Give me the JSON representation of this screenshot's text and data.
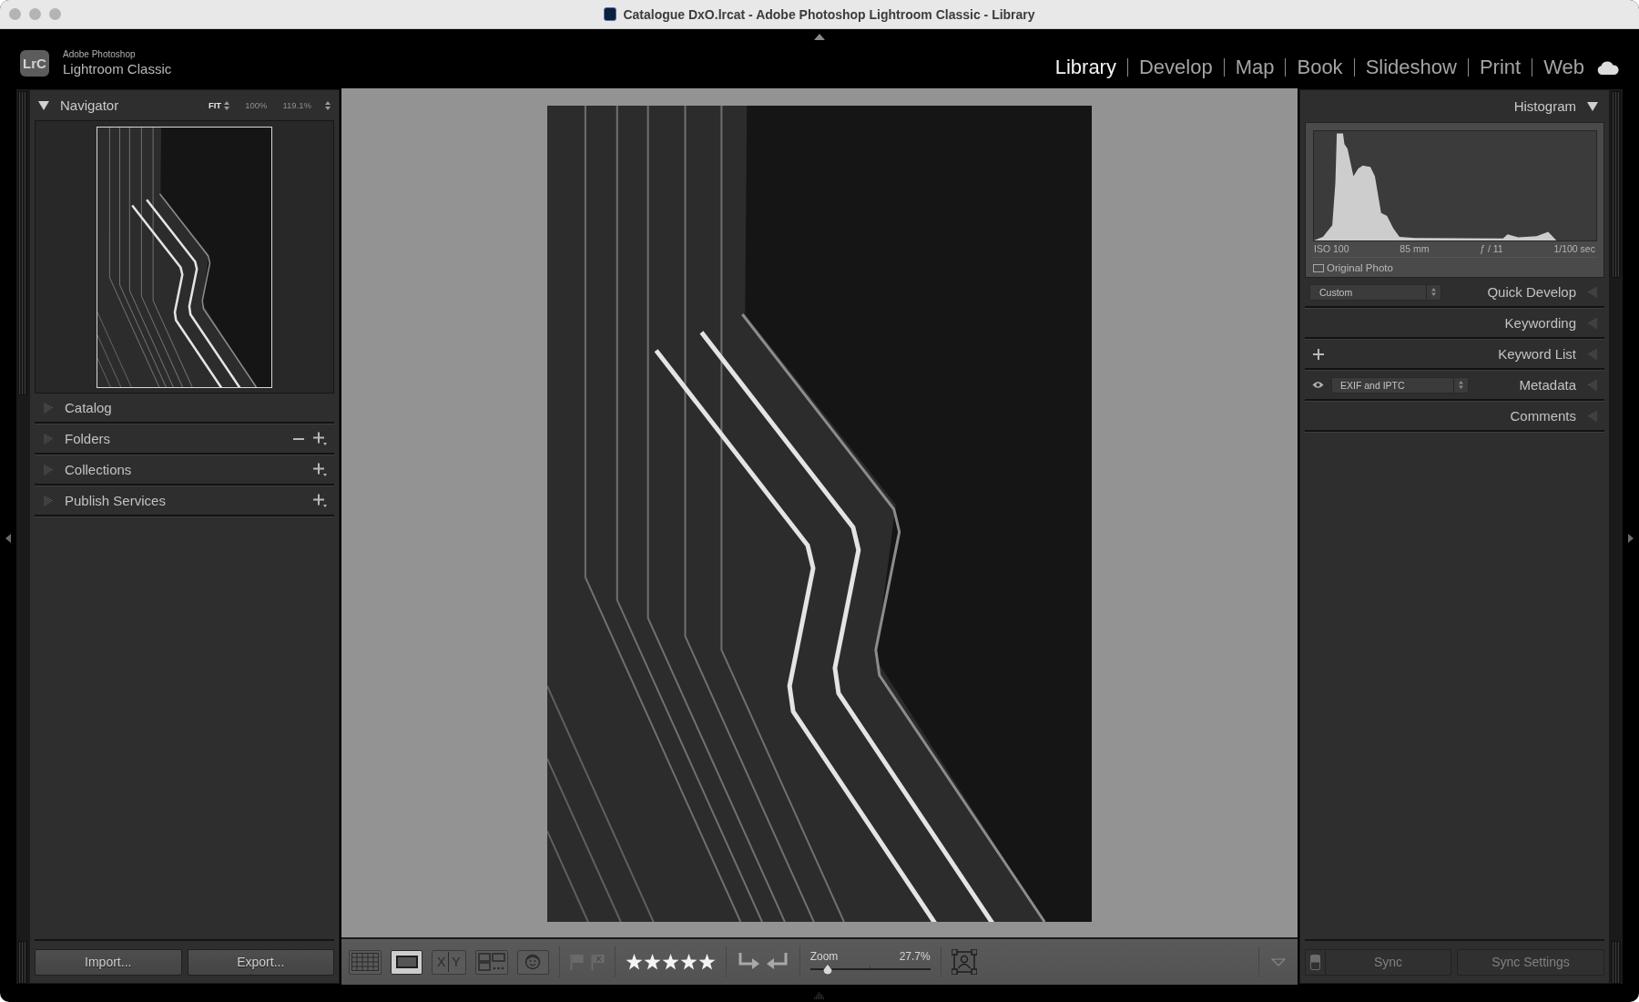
{
  "window": {
    "title": "Catalogue DxO.lrcat - Adobe Photoshop Lightroom Classic - Library"
  },
  "identity_plate": {
    "badge": "LrC",
    "vendor": "Adobe Photoshop",
    "product": "Lightroom Classic"
  },
  "modules": [
    {
      "label": "Library",
      "selected": true
    },
    {
      "label": "Develop",
      "selected": false
    },
    {
      "label": "Map",
      "selected": false
    },
    {
      "label": "Book",
      "selected": false
    },
    {
      "label": "Slideshow",
      "selected": false
    },
    {
      "label": "Print",
      "selected": false
    },
    {
      "label": "Web",
      "selected": false
    }
  ],
  "left_panel": {
    "navigator": {
      "title": "Navigator",
      "expanded": true,
      "zoom_options": [
        {
          "label": "FIT",
          "selected": true
        },
        {
          "label": "100%",
          "selected": false
        },
        {
          "label": "119.1%",
          "selected": false
        }
      ]
    },
    "sections": [
      {
        "title": "Catalog",
        "expanded": false
      },
      {
        "title": "Folders",
        "expanded": false,
        "actions": [
          {
            "kind": "remove"
          },
          {
            "kind": "add"
          }
        ]
      },
      {
        "title": "Collections",
        "expanded": false,
        "actions": [
          {
            "kind": "add"
          }
        ]
      },
      {
        "title": "Publish Services",
        "expanded": false,
        "actions": [
          {
            "kind": "add"
          }
        ]
      }
    ],
    "buttons": [
      {
        "label": "Import...",
        "disabled": false
      },
      {
        "label": "Export...",
        "disabled": false
      }
    ]
  },
  "toolbar": {
    "view_modes": [
      {
        "kind": "grid",
        "selected": false
      },
      {
        "kind": "loupe",
        "selected": true
      },
      {
        "kind": "compare",
        "selected": false,
        "glyphs": [
          "X",
          "Y"
        ]
      },
      {
        "kind": "survey",
        "selected": false
      },
      {
        "kind": "people",
        "selected": false
      }
    ],
    "flags": [
      {
        "kind": "pick",
        "on": false
      },
      {
        "kind": "reject",
        "on": false
      }
    ],
    "rating": {
      "stars": 5
    },
    "zoom": {
      "label": "Zoom",
      "level": 0.15,
      "reading": "27.7%"
    }
  },
  "right_panel": {
    "histogram": {
      "title": "Histogram",
      "expanded": true,
      "exif": [
        "ISO 100",
        "85 mm",
        "ƒ / 11",
        "1/100 sec"
      ],
      "original_photo": {
        "label": "Original Photo",
        "checked": false
      }
    },
    "sections": [
      {
        "title": "Quick Develop",
        "expanded": false,
        "kind": "preset",
        "preset": "Custom"
      },
      {
        "title": "Keywording",
        "expanded": false,
        "kind": "plain"
      },
      {
        "title": "Keyword List",
        "expanded": false,
        "kind": "add"
      },
      {
        "title": "Metadata",
        "expanded": false,
        "kind": "visibility_preset",
        "preset": "EXIF and IPTC"
      },
      {
        "title": "Comments",
        "expanded": false,
        "kind": "plain"
      }
    ],
    "sync": {
      "auto_sync_on": false,
      "buttons": [
        {
          "label": "Sync",
          "disabled": true
        },
        {
          "label": "Sync Settings",
          "disabled": true
        }
      ]
    }
  }
}
